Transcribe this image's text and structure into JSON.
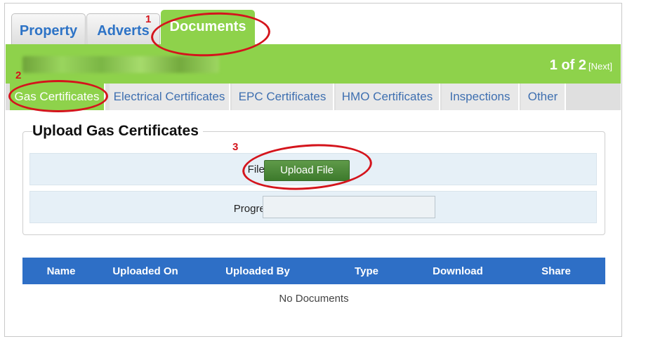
{
  "top_tabs": {
    "property": "Property",
    "adverts": "Adverts",
    "documents": "Documents"
  },
  "header": {
    "pager_text": "1 of 2",
    "pager_next": "[Next]"
  },
  "sub_tabs": {
    "gas": "Gas Certificates",
    "electrical": "Electrical Certificates",
    "epc": "EPC Certificates",
    "hmo": "HMO Certificates",
    "inspections": "Inspections",
    "other": "Other"
  },
  "upload": {
    "legend": "Upload Gas Certificates",
    "file_label": "File:",
    "upload_button": "Upload File",
    "progress_label": "Progress:"
  },
  "table": {
    "columns": [
      "Name",
      "Uploaded On",
      "Uploaded By",
      "Type",
      "Download",
      "Share"
    ],
    "empty_message": "No Documents"
  },
  "annotations": {
    "step1": "1",
    "step2": "2",
    "step3": "3"
  },
  "colors": {
    "green_accent": "#8ed24b",
    "link_blue": "#2d73c6",
    "table_header_blue": "#2e6fc6",
    "button_green": "#4a8838",
    "annotation_red": "#d4141c"
  }
}
